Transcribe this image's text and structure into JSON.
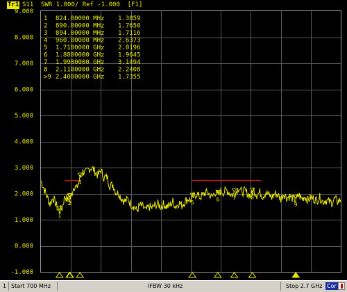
{
  "trace": {
    "tag": "Tr1",
    "title": "S11  SWR 1.000/ Ref -1.000  [F1]",
    "color": "#e8e800"
  },
  "status_bar": {
    "channel": "1",
    "start": "Start 700 MHz",
    "ifbw": "IFBW 30 kHz",
    "stop": "Stop 2.7 GHz",
    "cor": "Cor"
  },
  "chart_data": {
    "type": "line",
    "title": "S11  SWR 1.000/ Ref -1.000  [F1]",
    "xlabel": "",
    "ylabel": "",
    "xlim": [
      0.7,
      2.7
    ],
    "x_unit": "GHz",
    "ylim": [
      -1.0,
      9.0
    ],
    "grid": true,
    "yticks": [
      "9.000",
      "8.000",
      "7.000",
      "6.000",
      "5.000",
      "4.000",
      "3.000",
      "2.000",
      "1.000",
      "0.000",
      "-1.000"
    ],
    "markers": [
      {
        "id": "1",
        "label": "1",
        "freq": "824.00000 MHz",
        "x": 0.824,
        "value": "1.3859",
        "y": 1.3859
      },
      {
        "id": "2",
        "label": "2",
        "freq": "890.00000 MHz",
        "x": 0.89,
        "value": "1.7650",
        "y": 1.765
      },
      {
        "id": "3",
        "label": "3",
        "freq": "894.00000 MHz",
        "x": 0.894,
        "value": "1.7116",
        "y": 1.7116
      },
      {
        "id": "4",
        "label": "4",
        "freq": "960.00000 MHz",
        "x": 0.96,
        "value": "2.6373",
        "y": 2.6373
      },
      {
        "id": "5",
        "label": "5",
        "freq": "1.7100000 GHz",
        "x": 1.71,
        "value": "2.0196",
        "y": 2.0196
      },
      {
        "id": "6",
        "label": "6",
        "freq": "1.8800000 GHz",
        "x": 1.88,
        "value": "1.9645",
        "y": 1.9645
      },
      {
        "id": "7",
        "label": "7",
        "freq": "1.9900000 GHz",
        "x": 1.99,
        "value": "3.1494",
        "y": 3.1494
      },
      {
        "id": "8",
        "label": "8",
        "freq": "2.1100000 GHz",
        "x": 2.11,
        "value": "2.2408",
        "y": 2.2408
      },
      {
        "id": "9",
        "label": ">9",
        "freq": "2.4000000 GHz",
        "x": 2.4,
        "value": "1.7355",
        "y": 1.7355
      }
    ],
    "limit_lines": [
      {
        "x": [
          0.86,
          0.96
        ],
        "y": 2.5,
        "color": "#e02020"
      },
      {
        "x": [
          1.71,
          2.17
        ],
        "y": 2.5,
        "color": "#e02020"
      }
    ],
    "series": [
      {
        "color": "#e8e800",
        "x": [
          0.7,
          0.72,
          0.74,
          0.76,
          0.78,
          0.8,
          0.82,
          0.84,
          0.86,
          0.88,
          0.9,
          0.92,
          0.94,
          0.96,
          0.98,
          1.0,
          1.02,
          1.04,
          1.06,
          1.08,
          1.1,
          1.12,
          1.14,
          1.16,
          1.18,
          1.2,
          1.22,
          1.24,
          1.26,
          1.28,
          1.3,
          1.32,
          1.34,
          1.36,
          1.38,
          1.4,
          1.42,
          1.44,
          1.46,
          1.48,
          1.5,
          1.52,
          1.54,
          1.56,
          1.58,
          1.6,
          1.62,
          1.64,
          1.66,
          1.68,
          1.7,
          1.72,
          1.74,
          1.76,
          1.78,
          1.8,
          1.82,
          1.84,
          1.86,
          1.88,
          1.9,
          1.92,
          1.94,
          1.96,
          1.98,
          2.0,
          2.02,
          2.04,
          2.06,
          2.08,
          2.1,
          2.12,
          2.14,
          2.16,
          2.18,
          2.2,
          2.22,
          2.24,
          2.26,
          2.28,
          2.3,
          2.32,
          2.34,
          2.36,
          2.38,
          2.4,
          2.42,
          2.44,
          2.46,
          2.48,
          2.5,
          2.52,
          2.54,
          2.56,
          2.58,
          2.6,
          2.62,
          2.64,
          2.66,
          2.68,
          2.7
        ],
        "values": [
          2.5,
          2.2,
          1.9,
          1.6,
          1.85,
          1.6,
          1.3,
          1.45,
          1.9,
          1.75,
          1.85,
          2.3,
          2.2,
          2.6,
          2.85,
          2.8,
          2.95,
          3.0,
          2.85,
          2.7,
          2.9,
          2.6,
          2.65,
          2.3,
          2.35,
          2.05,
          2.0,
          1.8,
          1.7,
          1.8,
          1.6,
          1.5,
          1.35,
          1.55,
          1.5,
          1.35,
          1.5,
          1.45,
          1.55,
          1.6,
          1.5,
          1.6,
          1.5,
          1.55,
          1.7,
          1.5,
          1.65,
          1.55,
          1.7,
          1.8,
          1.75,
          1.9,
          2.0,
          1.85,
          1.95,
          2.05,
          2.0,
          1.85,
          2.05,
          1.95,
          2.1,
          2.05,
          2.15,
          2.0,
          1.95,
          2.05,
          2.25,
          2.05,
          2.1,
          2.0,
          1.9,
          2.15,
          1.95,
          2.05,
          1.9,
          2.05,
          1.95,
          1.85,
          2.0,
          1.95,
          1.8,
          2.0,
          1.85,
          1.9,
          1.8,
          1.75,
          1.95,
          1.8,
          1.9,
          1.75,
          1.85,
          1.8,
          1.75,
          1.85,
          1.7,
          1.75,
          1.7,
          1.65,
          1.8,
          1.7,
          1.75
        ]
      }
    ]
  }
}
